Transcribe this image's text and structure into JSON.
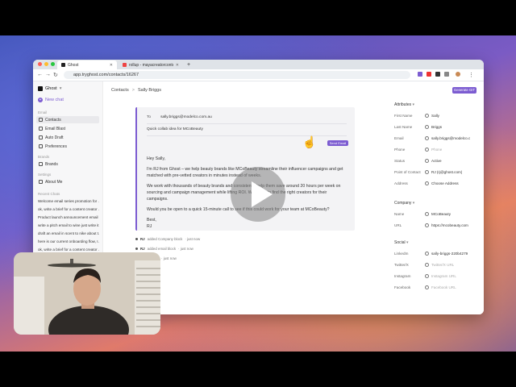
{
  "browser": {
    "tabs": [
      {
        "label": "Ghost",
        "active": true
      },
      {
        "label": "rollup - mayacreatorcontent",
        "active": false
      }
    ],
    "new_tab": "+",
    "url": "app.tryghost.com/contacts/16267"
  },
  "sidebar": {
    "workspace": "Ghost",
    "new_chat": "New chat",
    "email_section": "Email",
    "email_items": [
      {
        "label": "Contacts",
        "icon": "contacts-icon",
        "selected": true
      },
      {
        "label": "Email Blast",
        "icon": "mail-icon",
        "selected": false
      },
      {
        "label": "Auto Draft",
        "icon": "pencil-icon",
        "selected": false
      },
      {
        "label": "Preferences",
        "icon": "sliders-icon",
        "selected": false
      }
    ],
    "brands_section": "Brands",
    "brands_items": [
      {
        "label": "Brands",
        "icon": "tag-icon"
      }
    ],
    "settings_section": "Settings",
    "settings_items": [
      {
        "label": "About Me",
        "icon": "user-icon"
      }
    ],
    "recent_section": "Recent Chats",
    "recent_chats": [
      "Welcome email series promotion for ...",
      "ok, write a brief for a content creator ...",
      "Product launch announcement email",
      "write a pitch email to wine just write it",
      "draft an email in scent to nike about t...",
      "here is our current onboarding flow, I...",
      "ok, write a brief for a content creator ..."
    ]
  },
  "breadcrumb": {
    "root": "Contacts",
    "separator": ">",
    "current": "Sally Briggs"
  },
  "composer": {
    "to_label": "To",
    "to_value": "sally.briggs@modelco.com.au",
    "subject": "Quick collab idea for MCoBeauty",
    "send_label": "Send Email",
    "body": [
      "Hey Sally,",
      "I'm RJ from Ghost – we help beauty brands like MCoBeauty streamline their influencer campaigns and get matched with pre-vetted creators in minutes instead of weeks.",
      "We work with thousands of beauty brands and consistently help them save around 20 hours per week on sourcing and campaign management while lifting ROI. We'd love to find the right creators for their campaigns.",
      "Would you be open to a quick 15-minute call to see if this could work for your team at MCoBeauty?",
      "Best,",
      "RJ"
    ]
  },
  "activity": [
    {
      "actor": "RJ",
      "text": "added Company block",
      "time": "· just now"
    },
    {
      "actor": "RJ",
      "text": "added email block",
      "time": "· just now"
    },
    {
      "actor": "",
      "text": "email sent",
      "time": "· just now"
    }
  ],
  "right_panel": {
    "generate_label": "Generate GIT",
    "attributes_label": "Attributes",
    "attributes": [
      {
        "key": "First Name",
        "value": "Sally",
        "placeholder": false
      },
      {
        "key": "Last Name",
        "value": "Briggs",
        "placeholder": false
      },
      {
        "key": "Email",
        "value": "sally.briggs@modelco.c",
        "placeholder": false
      },
      {
        "key": "Phone",
        "value": "Phone",
        "placeholder": true
      },
      {
        "key": "Status",
        "value": "Active",
        "placeholder": false
      },
      {
        "key": "Point of Contact",
        "value": "RJ (rj@ghost.com)",
        "placeholder": false
      },
      {
        "key": "Address",
        "value": "Choose Address",
        "placeholder": false
      }
    ],
    "company_label": "Company",
    "company": [
      {
        "key": "Name",
        "value": "MCoBeauty",
        "placeholder": false
      },
      {
        "key": "URL",
        "value": "https://mcobeauty.com",
        "placeholder": false
      }
    ],
    "social_label": "Social",
    "social": [
      {
        "key": "LinkedIn",
        "value": "sally-briggs-220b4279",
        "placeholder": false
      },
      {
        "key": "Twitter/X",
        "value": "Twitter/X URL",
        "placeholder": true
      },
      {
        "key": "Instagram",
        "value": "Instagram URL",
        "placeholder": true
      },
      {
        "key": "Facebook",
        "value": "Facebook URL",
        "placeholder": true
      }
    ]
  },
  "colors": {
    "accent": "#7c5cd1"
  }
}
